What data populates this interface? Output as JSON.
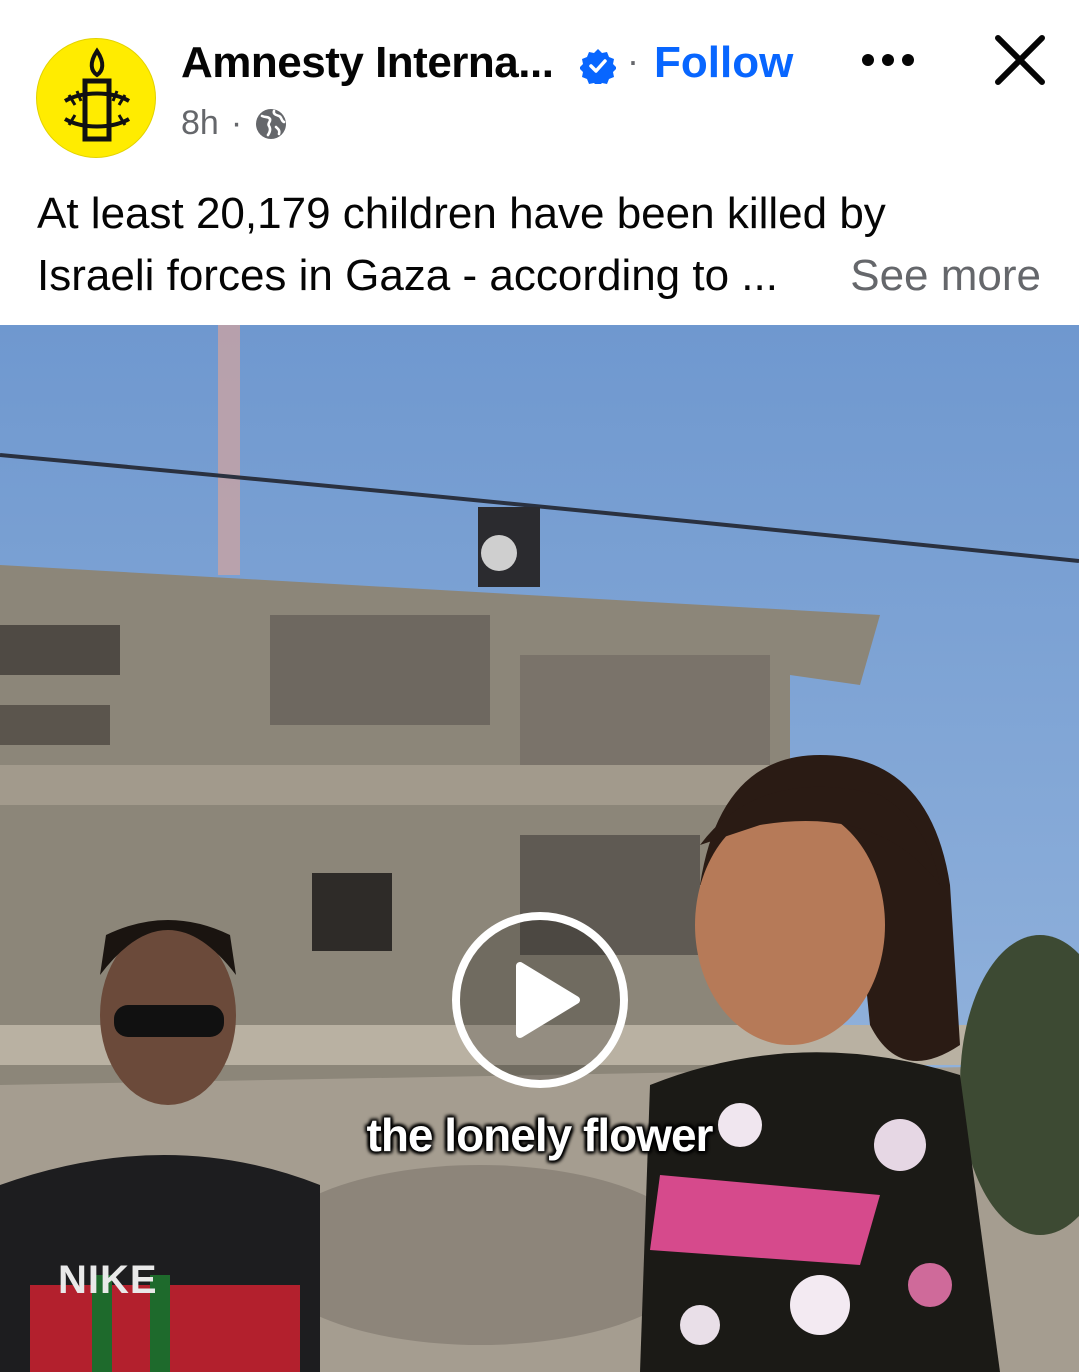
{
  "post": {
    "page_name": "Amnesty Interna...",
    "follow_label": "Follow",
    "separator": "·",
    "time": "8h",
    "audience_icon": "globe-icon",
    "caption_line1": "At least 20,179 children have been killed by",
    "caption_line2": "Israeli forces in Gaza - according to ...",
    "see_more": "See more"
  },
  "video": {
    "subtitle": "the lonely flower",
    "shirt_text": "NIKE",
    "play_icon": "play-icon"
  },
  "colors": {
    "link_blue": "#0866ff",
    "avatar_yellow": "#ffec00",
    "secondary_text": "#65676b"
  }
}
